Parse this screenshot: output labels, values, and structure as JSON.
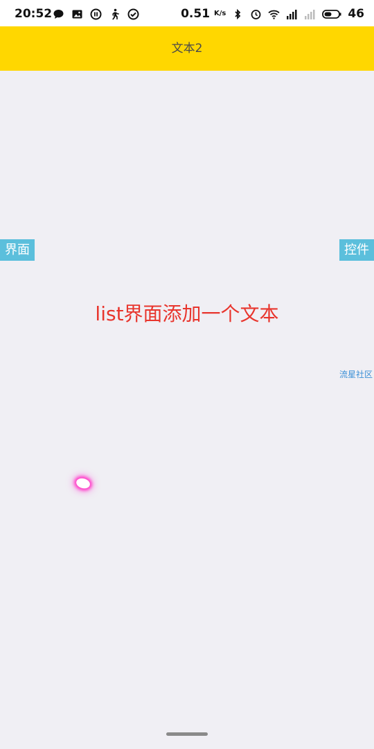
{
  "status_bar": {
    "time": "20:52",
    "network_speed": "0.51",
    "speed_unit": "K/s",
    "battery_level": "46",
    "icons": [
      "chat-icon",
      "image-icon",
      "pause-circle-icon",
      "walk-icon",
      "check-circle-icon",
      "bluetooth-icon",
      "alarm-icon",
      "wifi-icon",
      "signal-icon",
      "signal-weak-icon",
      "battery-icon"
    ]
  },
  "toolbar": {
    "title": "文本2",
    "background": "#ffd700"
  },
  "side_tabs": {
    "left_label": "界面",
    "right_label": "控件",
    "color": "#5bbfdc"
  },
  "content": {
    "center_text": "list界面添加一个文本",
    "center_color": "#e8352d",
    "community_link": "流星社区"
  }
}
